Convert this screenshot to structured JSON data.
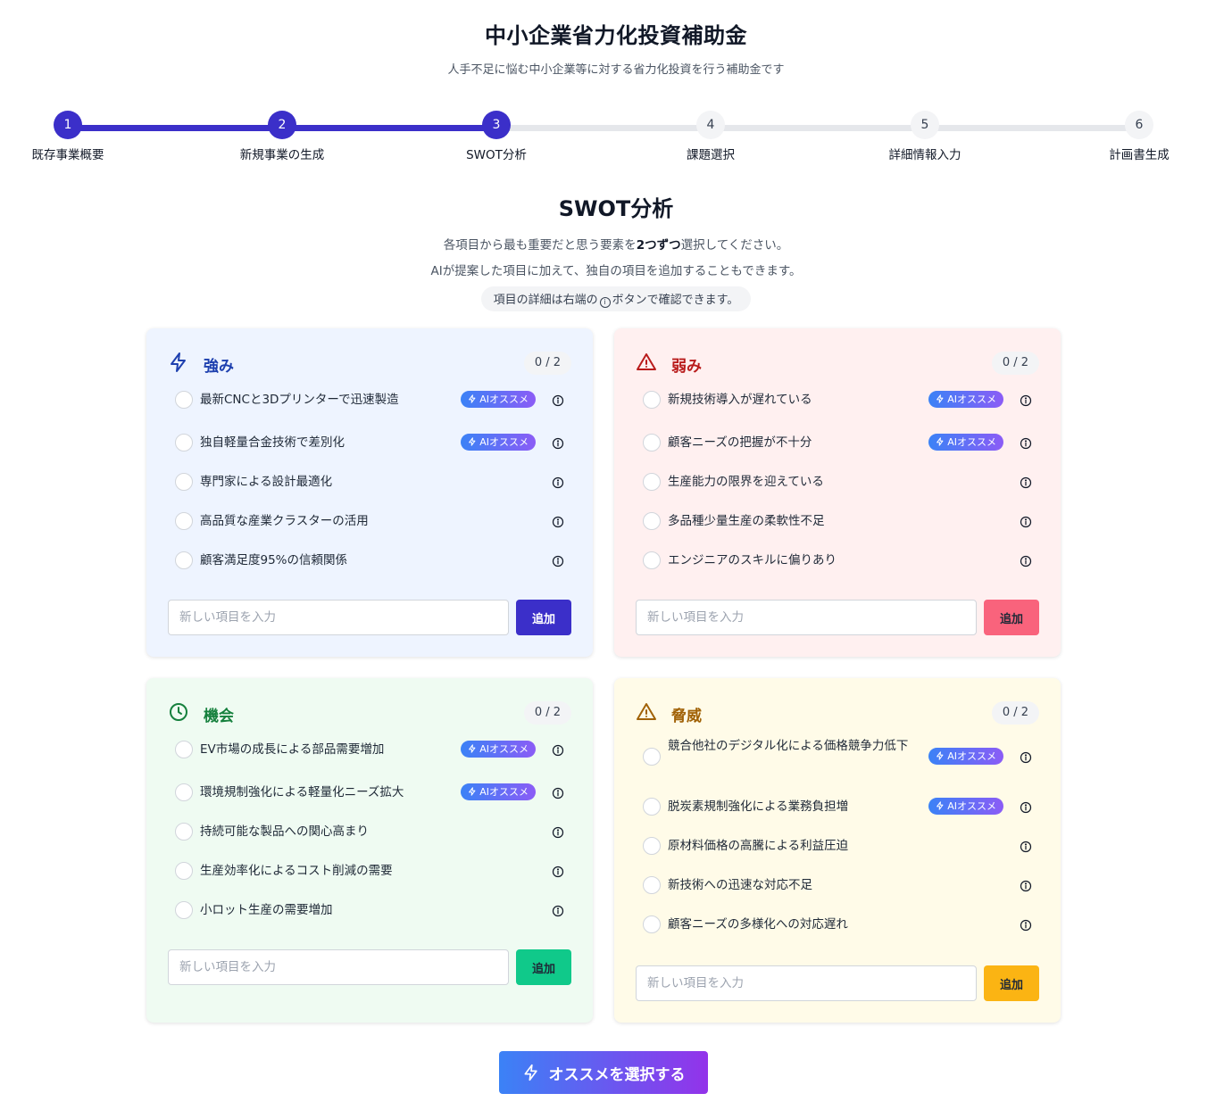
{
  "header": {
    "title": "中小企業省力化投資補助金",
    "subtitle": "人手不足に悩む中小企業等に対する省力化投資を行う補助金です"
  },
  "steps": [
    {
      "number": "1",
      "label": "既存事業概要"
    },
    {
      "number": "2",
      "label": "新規事業の生成"
    },
    {
      "number": "3",
      "label": "SWOT分析"
    },
    {
      "number": "4",
      "label": "課題選択"
    },
    {
      "number": "5",
      "label": "詳細情報入力"
    },
    {
      "number": "6",
      "label": "計画書生成"
    }
  ],
  "current_step": 3,
  "section": {
    "title": "SWOT分析",
    "desc_line1_pre": "各項目から最も重要だと思う要素を",
    "desc_line1_bold": "2つずつ",
    "desc_line1_post": "選択してください。",
    "desc_line2": "AIが提案した項目に加えて、独自の項目を追加することもできます。",
    "hint_pre": "項目の詳細は右端の",
    "hint_post": "ボタンで確認できます。"
  },
  "ai_badge_label": "AIオススメ",
  "input_placeholder": "新しい項目を入力",
  "add_label": "追加",
  "cards": {
    "strength": {
      "title": "強み",
      "count": "0 / 2",
      "icon": "lightning-icon",
      "color": "#1e40af",
      "button_color": "#3b2fc9",
      "items": [
        {
          "label": "最新CNCと3Dプリンターで迅速製造",
          "ai": true
        },
        {
          "label": "独自軽量合金技術で差別化",
          "ai": true
        },
        {
          "label": "専門家による設計最適化",
          "ai": false
        },
        {
          "label": "高品質な産業クラスターの活用",
          "ai": false
        },
        {
          "label": "顧客満足度95%の信頼関係",
          "ai": false
        }
      ]
    },
    "weakness": {
      "title": "弱み",
      "count": "0 / 2",
      "icon": "warning-triangle-icon",
      "color": "#b91c1c",
      "button_color": "#f9637c",
      "items": [
        {
          "label": "新規技術導入が遅れている",
          "ai": true
        },
        {
          "label": "顧客ニーズの把握が不十分",
          "ai": true
        },
        {
          "label": "生産能力の限界を迎えている",
          "ai": false
        },
        {
          "label": "多品種少量生産の柔軟性不足",
          "ai": false
        },
        {
          "label": "エンジニアのスキルに偏りあり",
          "ai": false
        }
      ]
    },
    "opportunity": {
      "title": "機会",
      "count": "0 / 2",
      "icon": "clock-icon",
      "color": "#15803d",
      "button_color": "#10c98a",
      "items": [
        {
          "label": "EV市場の成長による部品需要増加",
          "ai": true
        },
        {
          "label": "環境規制強化による軽量化ニーズ拡大",
          "ai": true
        },
        {
          "label": "持続可能な製品への関心高まり",
          "ai": false
        },
        {
          "label": "生産効率化によるコスト削減の需要",
          "ai": false
        },
        {
          "label": "小ロット生産の需要増加",
          "ai": false
        }
      ]
    },
    "threat": {
      "title": "脅威",
      "count": "0 / 2",
      "icon": "alert-triangle-icon",
      "color": "#a16207",
      "button_color": "#fbb413",
      "items": [
        {
          "label": "競合他社のデジタル化による価格競争力低下",
          "ai": true
        },
        {
          "label": "脱炭素規制強化による業務負担増",
          "ai": true
        },
        {
          "label": "原材料価格の高騰による利益圧迫",
          "ai": false
        },
        {
          "label": "新技術への迅速な対応不足",
          "ai": false
        },
        {
          "label": "顧客ニーズの多様化への対応遅れ",
          "ai": false
        }
      ]
    }
  },
  "recommend_button": "オススメを選択する"
}
